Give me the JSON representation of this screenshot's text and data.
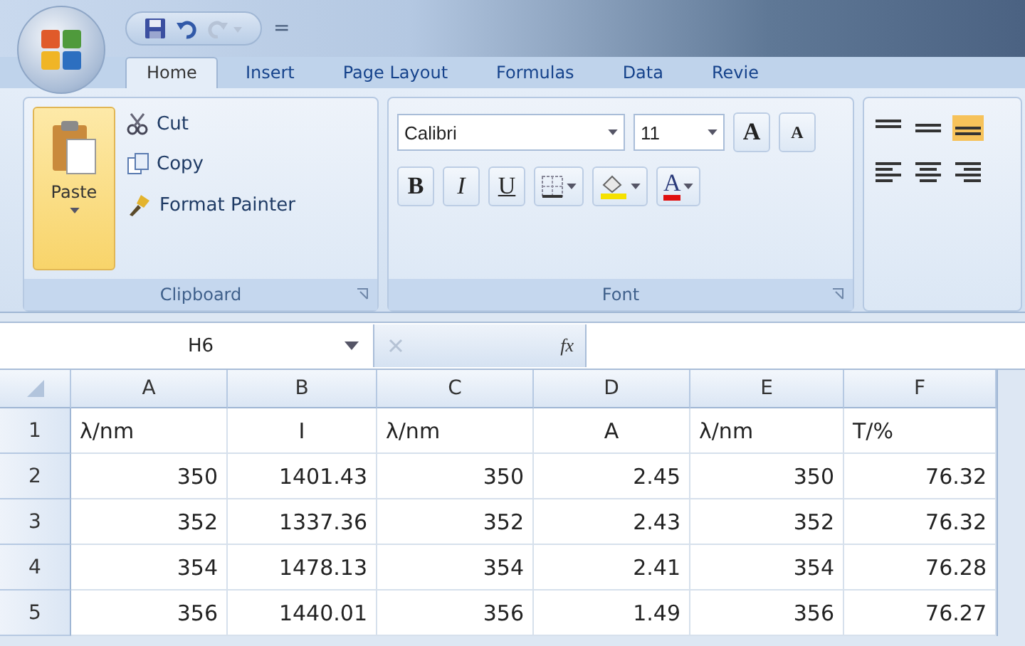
{
  "quick_access": {
    "customize": "="
  },
  "tabs": [
    {
      "label": "Home",
      "selected": true
    },
    {
      "label": "Insert",
      "selected": false
    },
    {
      "label": "Page Layout",
      "selected": false
    },
    {
      "label": "Formulas",
      "selected": false
    },
    {
      "label": "Data",
      "selected": false
    },
    {
      "label": "Revie",
      "selected": false
    }
  ],
  "clipboard": {
    "paste": "Paste",
    "cut": "Cut",
    "copy": "Copy",
    "format_painter": "Format Painter",
    "label": "Clipboard"
  },
  "font": {
    "family": "Calibri",
    "size": "11",
    "grow": "A",
    "shrink": "A",
    "bold": "B",
    "italic": "I",
    "underline": "U",
    "font_color": "A",
    "label": "Font"
  },
  "formula_bar": {
    "name_box": "H6",
    "fx": "fx"
  },
  "sheet": {
    "columns": [
      "A",
      "B",
      "C",
      "D",
      "E",
      "F"
    ],
    "rows": [
      {
        "header": "1",
        "cells": [
          {
            "text": "λ/nm",
            "kind": "left"
          },
          {
            "text": "I",
            "kind": "center"
          },
          {
            "text": "λ/nm",
            "kind": "left"
          },
          {
            "text": "A",
            "kind": "center"
          },
          {
            "text": "λ/nm",
            "kind": "left"
          },
          {
            "text": "T/%",
            "kind": "left"
          }
        ]
      },
      {
        "header": "2",
        "cells": [
          {
            "text": "350",
            "kind": "number"
          },
          {
            "text": "1401.43",
            "kind": "number"
          },
          {
            "text": "350",
            "kind": "number"
          },
          {
            "text": "2.45",
            "kind": "number"
          },
          {
            "text": "350",
            "kind": "number"
          },
          {
            "text": "76.32",
            "kind": "number"
          }
        ]
      },
      {
        "header": "3",
        "cells": [
          {
            "text": "352",
            "kind": "number"
          },
          {
            "text": "1337.36",
            "kind": "number"
          },
          {
            "text": "352",
            "kind": "number"
          },
          {
            "text": "2.43",
            "kind": "number"
          },
          {
            "text": "352",
            "kind": "number"
          },
          {
            "text": "76.32",
            "kind": "number"
          }
        ]
      },
      {
        "header": "4",
        "cells": [
          {
            "text": "354",
            "kind": "number"
          },
          {
            "text": "1478.13",
            "kind": "number"
          },
          {
            "text": "354",
            "kind": "number"
          },
          {
            "text": "2.41",
            "kind": "number"
          },
          {
            "text": "354",
            "kind": "number"
          },
          {
            "text": "76.28",
            "kind": "number"
          }
        ]
      },
      {
        "header": "5",
        "cells": [
          {
            "text": "356",
            "kind": "number"
          },
          {
            "text": "1440.01",
            "kind": "number"
          },
          {
            "text": "356",
            "kind": "number"
          },
          {
            "text": "1.49",
            "kind": "number"
          },
          {
            "text": "356",
            "kind": "number"
          },
          {
            "text": "76.27",
            "kind": "number"
          }
        ]
      }
    ]
  }
}
